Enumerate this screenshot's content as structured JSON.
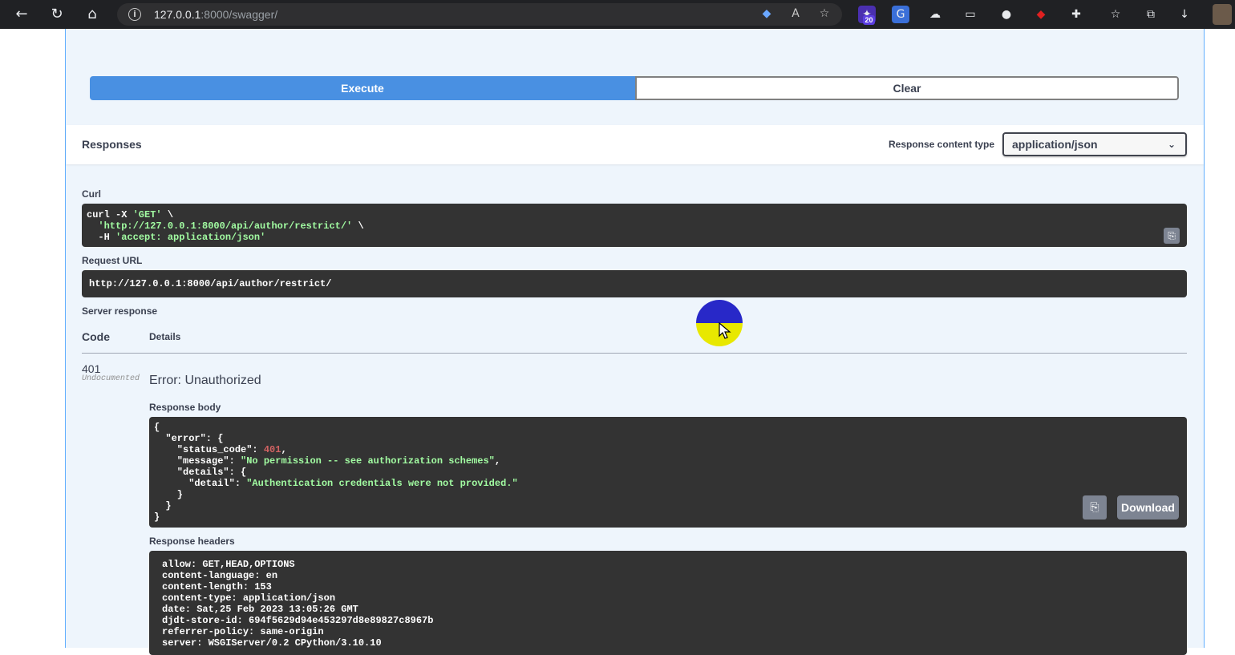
{
  "browser": {
    "url_host": "127.0.0.1",
    "url_rest": ":8000/swagger/",
    "extension_badge": "20"
  },
  "actions": {
    "execute_label": "Execute",
    "clear_label": "Clear"
  },
  "responses": {
    "title": "Responses",
    "content_type_label": "Response content type",
    "content_type_value": "application/json"
  },
  "curl": {
    "label": "Curl",
    "line1_cmd": "curl -X ",
    "line1_str": "'GET'",
    "line1_end": " \\",
    "line2_str": "'http://127.0.0.1:8000/api/author/restrict/'",
    "line2_end": " \\",
    "line3_cmd": "  -H ",
    "line3_str": "'accept: application/json'"
  },
  "request_url": {
    "label": "Request URL",
    "value": "http://127.0.0.1:8000/api/author/restrict/"
  },
  "server_response": {
    "label": "Server response",
    "col_code": "Code",
    "col_details": "Details",
    "code": "401",
    "undocumented": "Undocumented",
    "error_title": "Error: Unauthorized",
    "body_label": "Response body",
    "body": {
      "l1": "{",
      "l2": "  \"error\": {",
      "l3_key": "    \"status_code\": ",
      "l3_val": "401",
      "l3_end": ",",
      "l4_key": "    \"message\": ",
      "l4_val": "\"No permission -- see authorization schemes\"",
      "l4_end": ",",
      "l5": "    \"details\": {",
      "l6_key": "      \"detail\": ",
      "l6_val": "\"Authentication credentials were not provided.\"",
      "l7": "    }",
      "l8": "  }",
      "l9": "}"
    },
    "download_label": "Download",
    "headers_label": "Response headers",
    "headers": [
      "allow: GET,HEAD,OPTIONS",
      "content-language: en",
      "content-length: 153",
      "content-type: application/json",
      "date: Sat,25 Feb 2023 13:05:26 GMT",
      "djdt-store-id: 694f5629d94e453297d8e89827c8967b",
      "referrer-policy: same-origin",
      "server: WSGIServer/0.2 CPython/3.10.10"
    ]
  }
}
